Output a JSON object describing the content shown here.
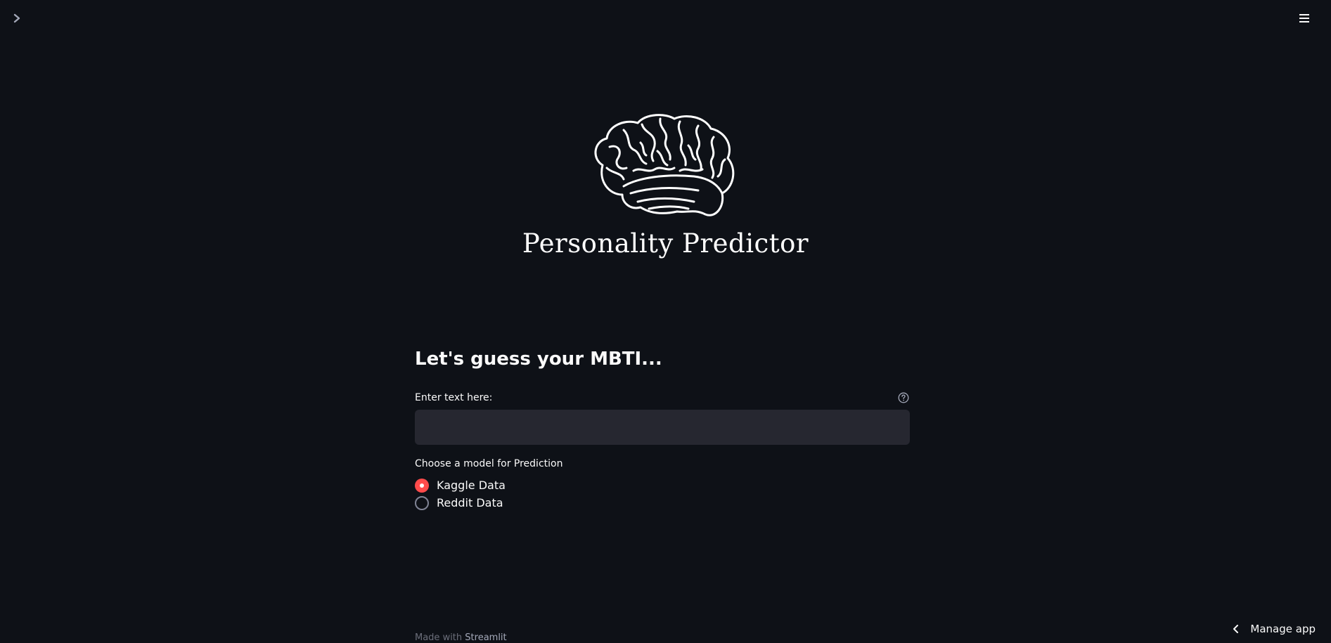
{
  "header": {
    "sidebar_toggle_icon": "chevron-right-icon",
    "menu_icon": "hamburger-menu-icon"
  },
  "hero": {
    "logo_icon": "brain-icon",
    "title": "Personality Predictor"
  },
  "main": {
    "heading": "Let's guess your MBTI...",
    "text_input": {
      "label": "Enter text here:",
      "value": "",
      "placeholder": "",
      "help_icon": "question-circle-icon"
    },
    "model_select": {
      "label": "Choose a model for Prediction",
      "options": [
        {
          "label": "Kaggle Data",
          "selected": true
        },
        {
          "label": "Reddit Data",
          "selected": false
        }
      ]
    }
  },
  "footer": {
    "prefix": "Made with ",
    "link": "Streamlit"
  },
  "manage_app": {
    "label": "Manage app",
    "icon": "chevron-left-icon"
  },
  "colors": {
    "background": "#0e1117",
    "input_background": "#262730",
    "accent": "#ff4b4b",
    "text": "#fafafa"
  }
}
